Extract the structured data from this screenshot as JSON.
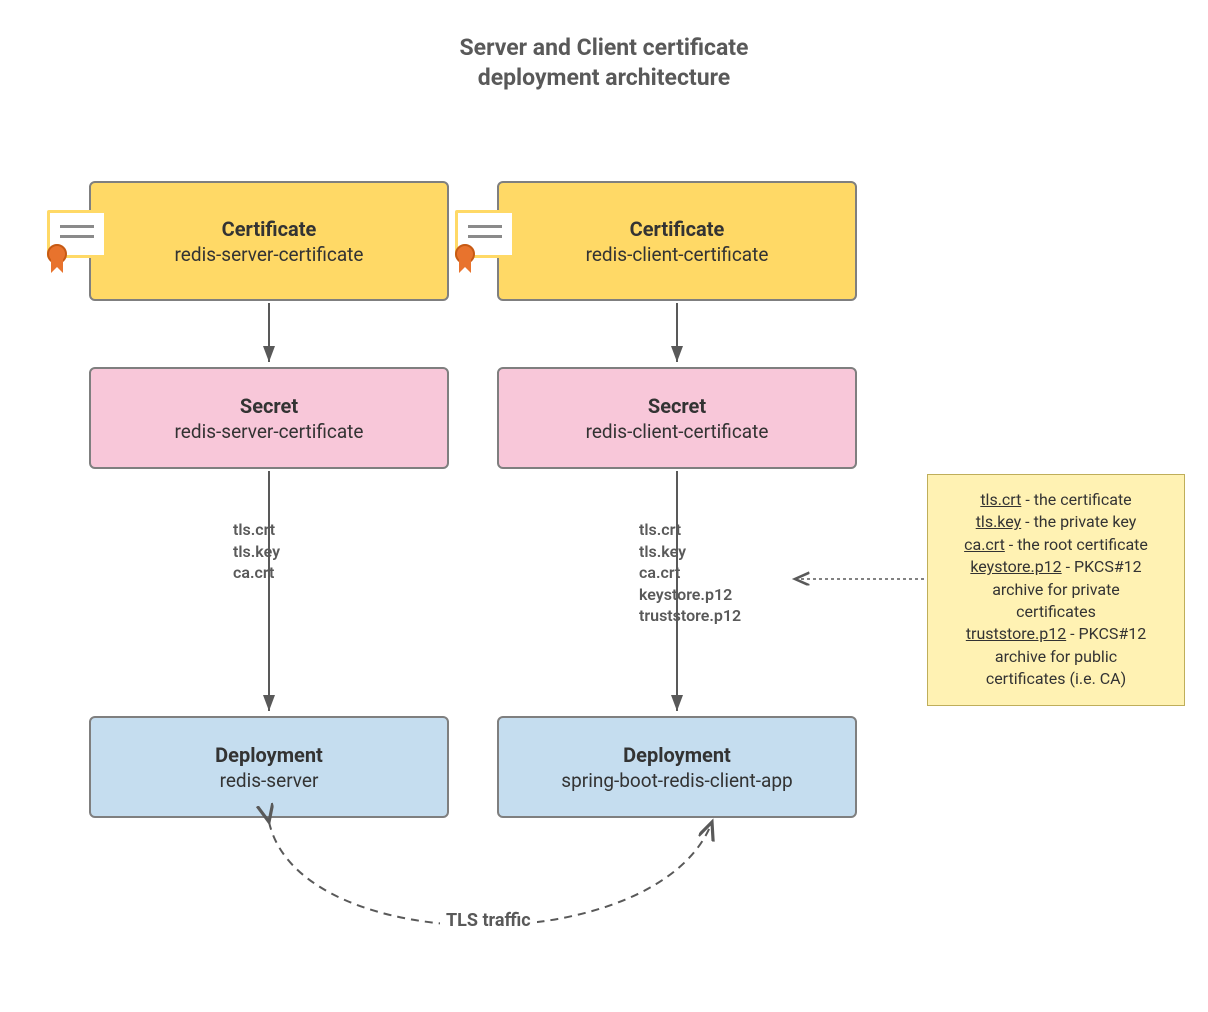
{
  "title_line1": "Server and Client certificate",
  "title_line2": "deployment architecture",
  "server": {
    "cert": {
      "type": "Certificate",
      "name": "redis-server-certificate"
    },
    "secret": {
      "type": "Secret",
      "name": "redis-server-certificate"
    },
    "files": [
      "tls.crt",
      "tls.key",
      "ca.crt"
    ],
    "deploy": {
      "type": "Deployment",
      "name": "redis-server"
    }
  },
  "client": {
    "cert": {
      "type": "Certificate",
      "name": "redis-client-certificate"
    },
    "secret": {
      "type": "Secret",
      "name": "redis-client-certificate"
    },
    "files": [
      "tls.crt",
      "tls.key",
      "ca.crt",
      "keystore.p12",
      "truststore.p12"
    ],
    "deploy": {
      "type": "Deployment",
      "name": "spring-boot-redis-client-app"
    }
  },
  "note": {
    "k1": "tls.crt",
    "v1": " - the certificate",
    "k2": "tls.key",
    "v2": " - the private key",
    "k3": "ca.crt",
    "v3": " - the root certificate",
    "k4": "keystore.p12",
    "v4a": " - PKCS#12",
    "v4b": "archive for private",
    "v4c": "certificates",
    "k5": "truststore.p12",
    "v5a": " - PKCS#12",
    "v5b": "archive for public",
    "v5c": "certificates (i.e. CA)"
  },
  "tls_label": "TLS traffic"
}
